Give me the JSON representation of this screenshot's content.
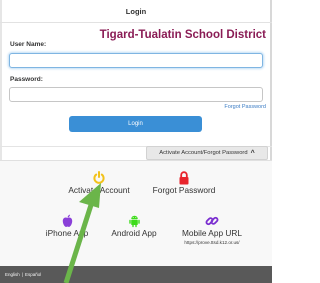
{
  "header": {
    "title": "Login"
  },
  "district_name": "Tigard-Tualatin School District",
  "form": {
    "username_label": "User Name:",
    "username_value": "",
    "password_label": "Password:",
    "password_value": "",
    "forgot_password_link": "Forgot Password",
    "login_button": "Login"
  },
  "toggle": {
    "label": "Activate Account/Forgot Password",
    "icon": "chevron-up-icon"
  },
  "links": {
    "activate_account": {
      "label": "Activate Account",
      "icon": "power-icon",
      "color": "#f2c21b"
    },
    "forgot_password": {
      "label": "Forgot Password",
      "icon": "lock-icon",
      "color": "#e8242c"
    },
    "iphone_app": {
      "label": "iPhone App",
      "icon": "apple-icon",
      "color": "#8a3fd8"
    },
    "android_app": {
      "label": "Android App",
      "icon": "android-icon",
      "color": "#3ddc1a"
    },
    "mobile_app_url": {
      "label": "Mobile App URL",
      "url": "https://prove.ttsd.k12.or.us/",
      "icon": "link-icon",
      "color": "#7b2fd0"
    }
  },
  "footer": {
    "lang_english": "English",
    "separator": "|",
    "lang_espanol": "Español"
  },
  "annotation_arrow": {
    "color": "#6bb54a"
  }
}
